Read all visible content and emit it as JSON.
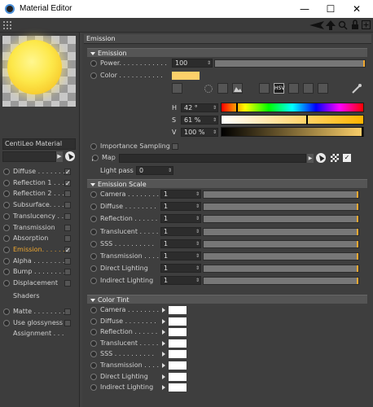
{
  "window": {
    "title": "Material Editor",
    "minimize": "—",
    "maximize": "☐",
    "close": "✕"
  },
  "left": {
    "material_name": "CentiLeo Material",
    "channels": [
      {
        "label": "Diffuse . . . . . . .",
        "checked": "✓"
      },
      {
        "label": "Reflection 1 . . .",
        "checked": "✓"
      },
      {
        "label": "Reflection 2 . . .",
        "checked": ""
      },
      {
        "label": "Subsurface. . . . .",
        "checked": ""
      },
      {
        "label": "Translucency . . .",
        "checked": ""
      },
      {
        "label": "Transmission",
        "checked": ""
      },
      {
        "label": "Absorption",
        "checked": ""
      },
      {
        "label": "Emission. . . . . .",
        "checked": "✓"
      },
      {
        "label": "Alpha . . . . . . . .",
        "checked": ""
      },
      {
        "label": "Bump . . . . . . . .",
        "checked": ""
      },
      {
        "label": "Displacement",
        "checked": ""
      }
    ],
    "shaders": "Shaders",
    "matte": "Matte . . . . . . . .",
    "use_glossyness": "Use glossyness",
    "assignment": "Assignment . . ."
  },
  "panel": {
    "header": "Emission",
    "emission_section": "Emission",
    "power_label": "Power. . . . . . . . . . . .",
    "power_value": "100",
    "color_label": "Color . . . . . . . . . . .",
    "color_hex": "#FCD06A",
    "hsv_label": "HSV",
    "h_label": "H",
    "h_value": "42 °",
    "s_label": "S",
    "s_value": "61 %",
    "v_label": "V",
    "v_value": "100 %",
    "h_fraction": 0.117,
    "s_fraction": 0.61,
    "v_fraction": 1.0,
    "importance_sampling": "Importance Sampling",
    "map_label": "Map",
    "light_pass_label": "Light pass",
    "light_pass_value": "0",
    "scale_section": "Emission Scale",
    "scale_rows": [
      {
        "label": "Camera . . . . . . . .",
        "value": "1"
      },
      {
        "label": "Diffuse . . . . . . . .",
        "value": "1"
      },
      {
        "label": "Reflection . . . . . .",
        "value": "1"
      },
      {
        "label": "Translucent . . . . .",
        "value": "1"
      },
      {
        "label": "SSS . . . . . . . . . .",
        "value": "1"
      },
      {
        "label": "Transmission . . . .",
        "value": "1"
      },
      {
        "label": "Direct Lighting",
        "value": "1"
      },
      {
        "label": "Indirect Lighting",
        "value": "1"
      }
    ],
    "tint_section": "Color Tint",
    "tint_rows": [
      {
        "label": "Camera . . . . . . . ."
      },
      {
        "label": "Diffuse . . . . . . . ."
      },
      {
        "label": "Reflection . . . . . ."
      },
      {
        "label": "Translucent . . . . ."
      },
      {
        "label": "SSS . . . . . . . . . ."
      },
      {
        "label": "Transmission . . . ."
      },
      {
        "label": "Direct Lighting"
      },
      {
        "label": "Indirect Lighting"
      }
    ]
  },
  "colors": {
    "accent": "#F0A830",
    "emission_color": "#FCD06A",
    "tint_white": "#FFFFFF"
  }
}
